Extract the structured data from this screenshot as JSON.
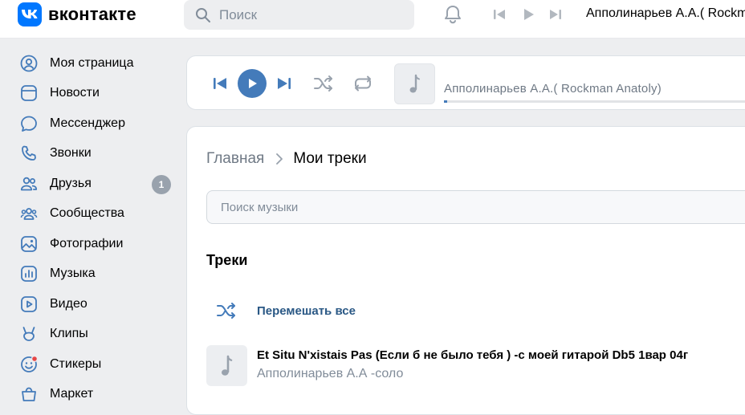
{
  "header": {
    "logo_text": "вконтакте",
    "search_placeholder": "Поиск",
    "now_playing": "Апполинарьев А.А.( Rockman Anatoly)"
  },
  "sidebar": {
    "items": [
      {
        "label": "Моя страница",
        "icon": "user-circle-icon"
      },
      {
        "label": "Новости",
        "icon": "news-icon"
      },
      {
        "label": "Мессенджер",
        "icon": "message-icon"
      },
      {
        "label": "Звонки",
        "icon": "phone-icon"
      },
      {
        "label": "Друзья",
        "icon": "friends-icon",
        "badge": "1"
      },
      {
        "label": "Сообщества",
        "icon": "communities-icon"
      },
      {
        "label": "Фотографии",
        "icon": "photo-icon"
      },
      {
        "label": "Музыка",
        "icon": "music-icon"
      },
      {
        "label": "Видео",
        "icon": "video-icon"
      },
      {
        "label": "Клипы",
        "icon": "clips-icon"
      },
      {
        "label": "Стикеры",
        "icon": "stickers-icon"
      },
      {
        "label": "Маркет",
        "icon": "market-icon"
      }
    ]
  },
  "player": {
    "track_title": "Апполинарьев А.А.( Rockman Anatoly)",
    "progress": 0.01
  },
  "main": {
    "breadcrumb_home": "Главная",
    "breadcrumb_current": "Мои треки",
    "search_placeholder": "Поиск музыки",
    "section_title": "Треки",
    "shuffle_label": "Перемешать все",
    "tracks": [
      {
        "title": "Et Situ N'xistais Pas (Если б не было тебя ) -с моей гитарой Db5 1вар 04г",
        "artist": "Апполинарьев А.А -соло"
      }
    ]
  },
  "colors": {
    "brand": "#0077ff",
    "accent": "#447bba",
    "link": "#2a5885",
    "badge": "#99a2ad",
    "notification_dot": "#e64646",
    "background": "#edeef0"
  }
}
